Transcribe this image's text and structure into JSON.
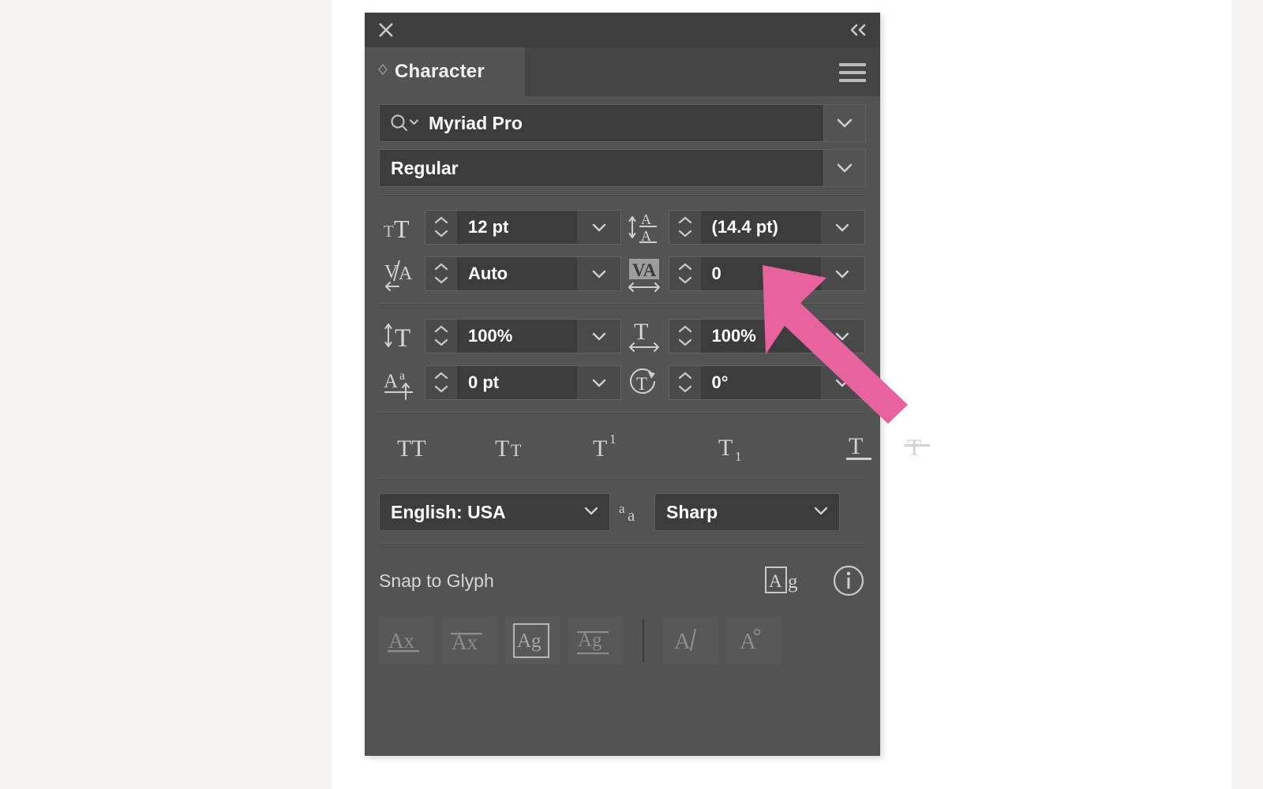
{
  "panel": {
    "title": "Character",
    "close_icon": "close-icon",
    "collapse_icon": "collapse-double-chevron-icon",
    "menu_icon": "hamburger-menu-icon",
    "grip_icon": "panel-grip-icon"
  },
  "font": {
    "family_value": "Myriad Pro",
    "family_search_icon": "search-icon",
    "style_value": "Regular",
    "dropdown_icon": "chevron-down-icon"
  },
  "metrics": {
    "size": {
      "label_icon": "font-size-icon",
      "value": "12 pt"
    },
    "leading": {
      "label_icon": "leading-icon",
      "value": "(14.4 pt)"
    },
    "kerning": {
      "label_icon": "kerning-icon",
      "value": "Auto"
    },
    "tracking": {
      "label_icon": "tracking-icon",
      "value": "0"
    },
    "vertical_scale": {
      "label_icon": "vertical-scale-icon",
      "value": "100%"
    },
    "horizontal_scale": {
      "label_icon": "horizontal-scale-icon",
      "value": "100%"
    },
    "baseline_shift": {
      "label_icon": "baseline-shift-icon",
      "value": "0 pt"
    },
    "rotation": {
      "label_icon": "character-rotation-icon",
      "value": "0°"
    }
  },
  "style_buttons": [
    {
      "name": "all-caps-button",
      "glyph": "TT"
    },
    {
      "name": "small-caps-button",
      "glyph": "Tᴛ"
    },
    {
      "name": "superscript-button",
      "glyph": "T¹"
    },
    {
      "name": "subscript-button",
      "glyph": "T₁"
    },
    {
      "name": "underline-button",
      "glyph": "T"
    },
    {
      "name": "strikethrough-button",
      "glyph": "Ŧ"
    }
  ],
  "language": {
    "value": "English: USA",
    "dropdown_icon": "chevron-down-icon"
  },
  "antialias": {
    "icon": "anti-alias-aa-icon",
    "value": "Sharp",
    "dropdown_icon": "chevron-down-icon"
  },
  "snap_to_glyph": {
    "label": "Snap to Glyph",
    "toggle_icon": "snap-to-glyph-ag-icon",
    "info_icon": "info-circle-icon"
  },
  "align_buttons": [
    {
      "name": "align-baseline-button",
      "glyph": "Ax"
    },
    {
      "name": "align-cap-height-button",
      "glyph": "Āx"
    },
    {
      "name": "align-em-box-button",
      "glyph": "Ag",
      "selected": true
    },
    {
      "name": "align-descender-button",
      "glyph": "Āg"
    },
    {
      "name": "align-italic-angle-button",
      "glyph": "A\\"
    },
    {
      "name": "align-glyph-bounds-button",
      "glyph": "A°"
    }
  ],
  "colors": {
    "panel_bg": "#535353",
    "titlebar_bg": "#3f3f3f",
    "tabstrip_bg": "#454545",
    "field_bg": "#3c3c3c",
    "field_border": "#606060",
    "text": "#ffffff",
    "muted_text": "#d6d6d6",
    "icon": "#bcbcbc",
    "cursor_pink": "#e8629e",
    "page_bg": "#ffffff",
    "outer_bg": "#f4f3f1"
  },
  "cursor": {
    "name": "mouse-pointer-arrow",
    "color": "#e8629e"
  }
}
